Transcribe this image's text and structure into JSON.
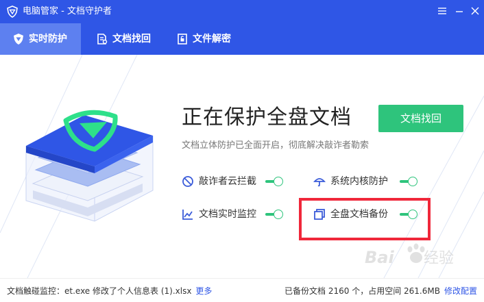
{
  "window": {
    "title": "电脑管家 - 文档守护者",
    "icons": {
      "logo": "shield-logo-icon",
      "menu": "menu-icon",
      "minimize": "minimize-icon",
      "close": "close-icon"
    }
  },
  "tabs": [
    {
      "label": "实时防护",
      "icon": "shield-tab-icon",
      "active": true
    },
    {
      "label": "文档找回",
      "icon": "document-search-icon",
      "active": false
    },
    {
      "label": "文件解密",
      "icon": "unlock-file-icon",
      "active": false
    }
  ],
  "main": {
    "headline": "正在保护全盘文档",
    "subtitle": "文档立体防护已全面开启，彻底解决敲诈者勒索",
    "recover_button": "文档找回",
    "features": [
      {
        "label": "敲诈者云拦截",
        "icon": "block-icon",
        "enabled": true
      },
      {
        "label": "系统内核防护",
        "icon": "umbrella-icon",
        "enabled": true
      },
      {
        "label": "文档实时监控",
        "icon": "chart-monitor-icon",
        "enabled": true
      },
      {
        "label": "全盘文档备份",
        "icon": "backup-copy-icon",
        "enabled": true
      }
    ]
  },
  "statusbar": {
    "monitor_text": "文档触碰监控：et.exe 修改了个人信息表 (1).xlsx",
    "more_link": "更多",
    "backup_text": "已备份文档 2160 个，占用空间 261.6MB",
    "config_link": "修改配置"
  },
  "watermark_text": "Baidu经验",
  "colors": {
    "brand_blue": "#2f56e6",
    "active_tab": "#5d80f0",
    "accent_green": "#2ec47c",
    "highlight_red": "#f0273a"
  }
}
